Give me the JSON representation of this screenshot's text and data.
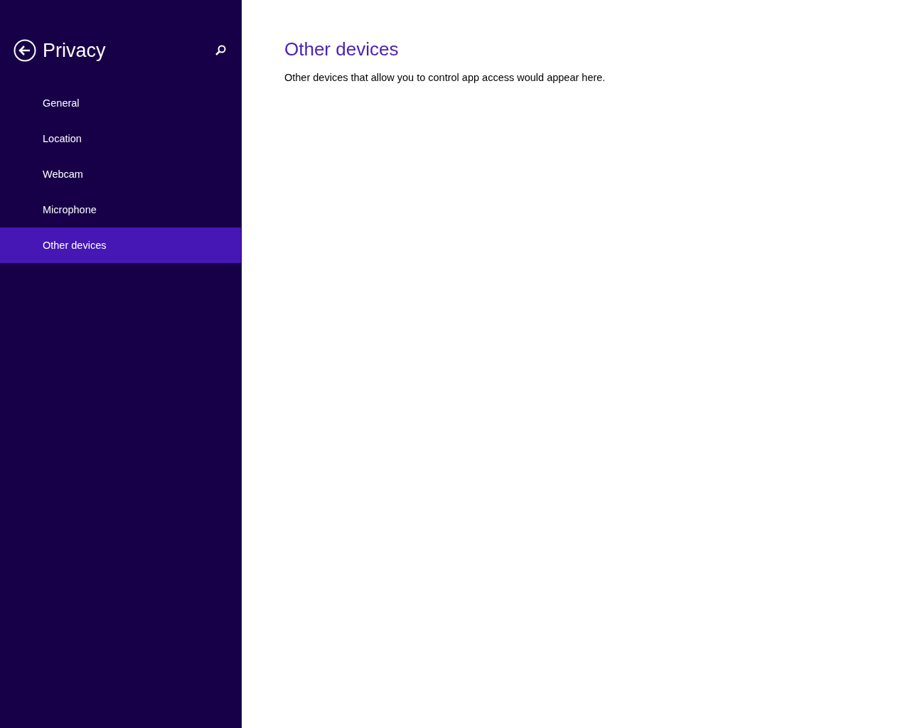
{
  "sidebar": {
    "title": "Privacy",
    "items": [
      {
        "label": "General",
        "selected": false
      },
      {
        "label": "Location",
        "selected": false
      },
      {
        "label": "Webcam",
        "selected": false
      },
      {
        "label": "Microphone",
        "selected": false
      },
      {
        "label": "Other devices",
        "selected": true
      }
    ]
  },
  "content": {
    "heading": "Other devices",
    "description": "Other devices that allow you to control app access would appear here."
  }
}
